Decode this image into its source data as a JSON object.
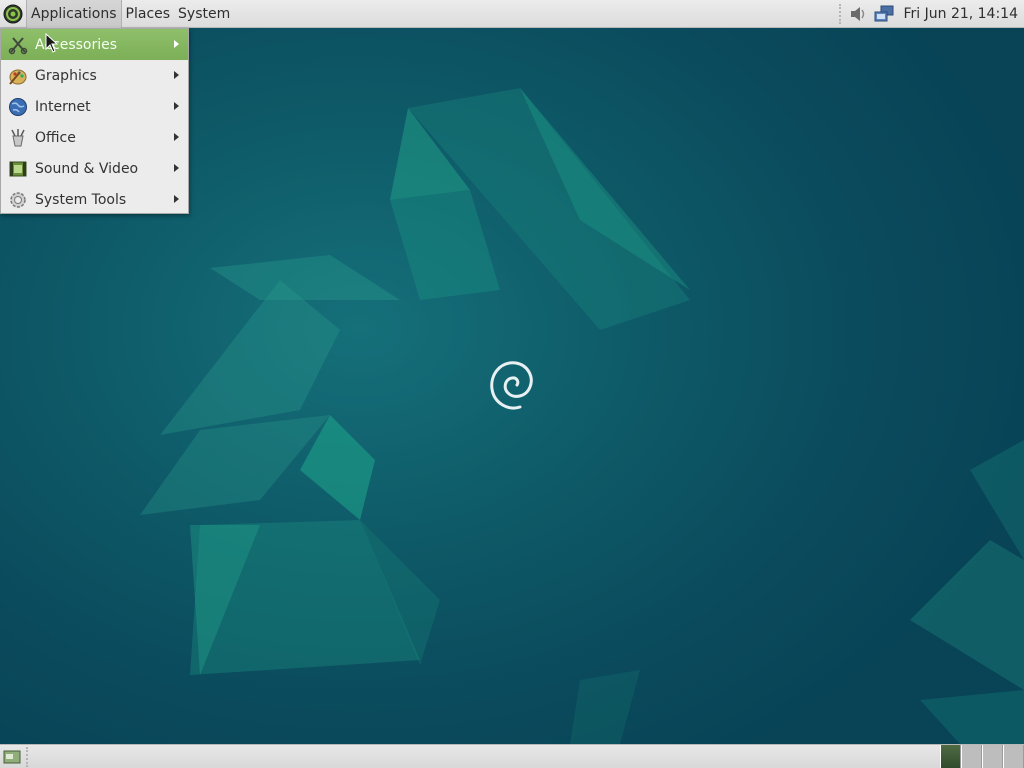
{
  "top_panel": {
    "menus": [
      {
        "label": "Applications",
        "active": true
      },
      {
        "label": "Places",
        "active": false
      },
      {
        "label": "System",
        "active": false
      }
    ],
    "clock": "Fri Jun 21, 14:14",
    "tray": [
      "volume-icon",
      "network-icon"
    ]
  },
  "applications_menu": {
    "items": [
      {
        "label": "Accessories",
        "icon": "accessories-icon",
        "selected": true
      },
      {
        "label": "Graphics",
        "icon": "graphics-icon",
        "selected": false
      },
      {
        "label": "Internet",
        "icon": "internet-icon",
        "selected": false
      },
      {
        "label": "Office",
        "icon": "office-icon",
        "selected": false
      },
      {
        "label": "Sound & Video",
        "icon": "sound-video-icon",
        "selected": false
      },
      {
        "label": "System Tools",
        "icon": "system-tools-icon",
        "selected": false
      }
    ]
  },
  "bottom_panel": {
    "workspaces": [
      {
        "active": true
      },
      {
        "active": false
      },
      {
        "active": false
      },
      {
        "active": false
      }
    ]
  },
  "colors": {
    "selection": "#86b861",
    "panel": "#e4e4e4",
    "desktop": "#0c4f5f"
  }
}
